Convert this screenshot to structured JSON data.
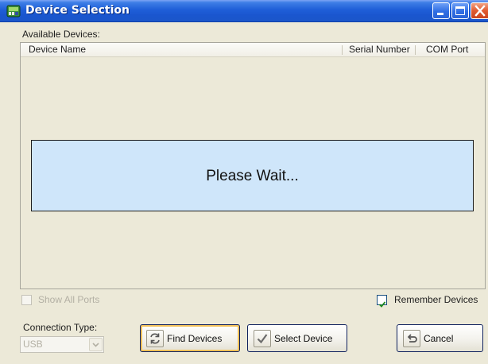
{
  "window": {
    "title": "Device Selection"
  },
  "devices": {
    "label": "Available Devices:",
    "columns": [
      "Device Name",
      "Serial Number",
      "COM Port"
    ],
    "rows": [],
    "status_message": "Please Wait..."
  },
  "options": {
    "show_all_ports": {
      "label": "Show All Ports",
      "checked": false,
      "enabled": false
    },
    "remember_devices": {
      "label": "Remember Devices",
      "checked": true,
      "enabled": true
    }
  },
  "connection": {
    "label": "Connection Type:",
    "selected": "USB",
    "enabled": false
  },
  "buttons": {
    "find": {
      "label": "Find Devices",
      "icon": "refresh-icon"
    },
    "select": {
      "label": "Select Device",
      "icon": "checkmark-icon"
    },
    "cancel": {
      "label": "Cancel",
      "icon": "undo-icon"
    }
  },
  "colors": {
    "titlebar": "#1f5fd8",
    "window_bg": "#ece9d8",
    "wait_panel": "#cfe6fa",
    "focus_ring": "#f3c25a"
  }
}
